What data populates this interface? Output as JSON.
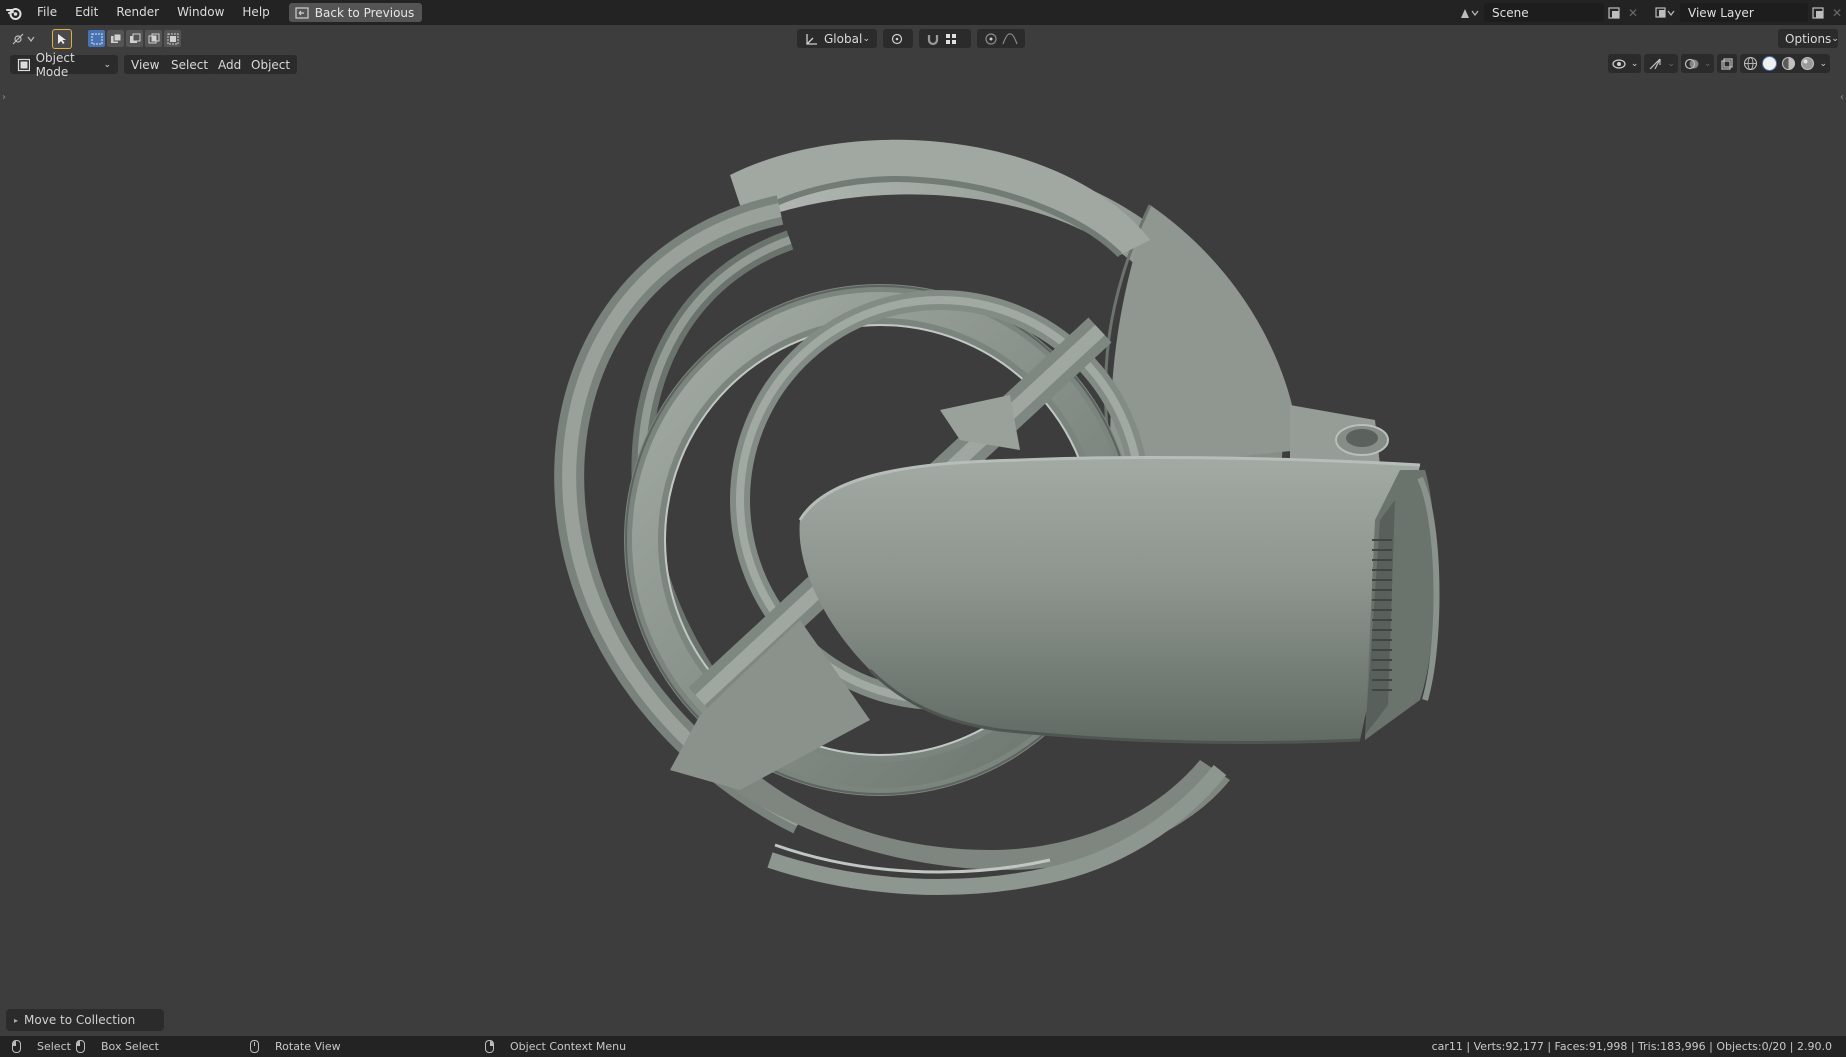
{
  "menu": {
    "items": [
      "File",
      "Edit",
      "Render",
      "Window",
      "Help"
    ],
    "back_button": "Back to Previous"
  },
  "scene": {
    "label": "Scene"
  },
  "view_layer": {
    "label": "View Layer"
  },
  "toolbar": {
    "orientation": "Global",
    "options": "Options"
  },
  "header": {
    "mode": "Object Mode",
    "view": "View",
    "select": "Select",
    "add": "Add",
    "object": "Object"
  },
  "redo_panel": {
    "label": "Move to Collection"
  },
  "status": {
    "select": "Select",
    "box_select": "Box Select",
    "rotate_view": "Rotate View",
    "context_menu": "Object Context Menu",
    "stats": "car11 | Verts:92,177 | Faces:91,998 | Tris:183,996 | Objects:0/20 | 2.90.0"
  },
  "colors": {
    "viewport_bg": "#3d3d3d",
    "header_bg": "#232323",
    "model_grey": "#8e958f",
    "select_blue": "#4772b3"
  },
  "icons": {
    "logo": "blender-logo-icon",
    "shading_solid": "solid-shading-icon"
  }
}
